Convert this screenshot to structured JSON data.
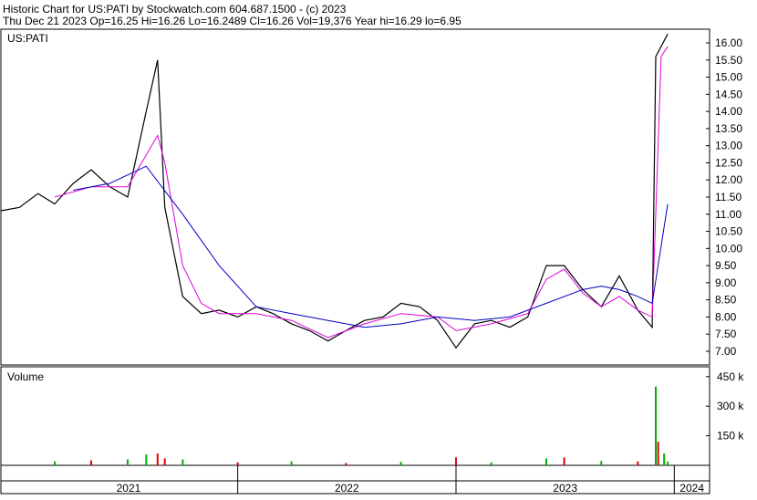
{
  "header": {
    "line1": "Historic Chart for US:PATI by Stockwatch.com 604.687.1500 - (c) 2023",
    "line2": "Thu Dec 21 2023   Op=16.25   Hi=16.26   Lo=16.2489   Cl=16.26   Vol=19,376   Year hi=16.29   lo=6.95"
  },
  "colors": {
    "price": "#000000",
    "ma_short": "#e000e0",
    "ma_long": "#0000c0",
    "vol_up": "#00b000",
    "vol_down": "#e00000",
    "grid": "#000000"
  },
  "chart_data": [
    {
      "type": "line",
      "title": "US:PATI",
      "x_labels": [
        "2021",
        "2022",
        "2023",
        "2024"
      ],
      "ylim": [
        6.6,
        16.4
      ],
      "y_ticks": [
        "7.00",
        "7.50",
        "8.00",
        "8.50",
        "9.00",
        "9.50",
        "10.00",
        "10.50",
        "11.00",
        "11.50",
        "12.00",
        "12.50",
        "13.00",
        "13.50",
        "14.00",
        "14.50",
        "15.00",
        "15.50",
        "16.00"
      ],
      "series": [
        {
          "key": "price",
          "points": [
            [
              "2020-12",
              11.1
            ],
            [
              "2021-01",
              11.2
            ],
            [
              "2021-02",
              11.6
            ],
            [
              "2021-03",
              11.3
            ],
            [
              "2021-04",
              11.9
            ],
            [
              "2021-05",
              12.3
            ],
            [
              "2021-06",
              11.8
            ],
            [
              "2021-07",
              11.5
            ],
            [
              "2021-08",
              14.0
            ],
            [
              "2021-08-20",
              15.5
            ],
            [
              "2021-09",
              11.2
            ],
            [
              "2021-10",
              8.6
            ],
            [
              "2021-11",
              8.1
            ],
            [
              "2021-12",
              8.2
            ],
            [
              "2022-01",
              8.0
            ],
            [
              "2022-02",
              8.3
            ],
            [
              "2022-03",
              8.1
            ],
            [
              "2022-04",
              7.8
            ],
            [
              "2022-05",
              7.6
            ],
            [
              "2022-06",
              7.3
            ],
            [
              "2022-07",
              7.6
            ],
            [
              "2022-08",
              7.9
            ],
            [
              "2022-09",
              8.0
            ],
            [
              "2022-10",
              8.4
            ],
            [
              "2022-11",
              8.3
            ],
            [
              "2022-12",
              7.9
            ],
            [
              "2023-01",
              7.1
            ],
            [
              "2023-02",
              7.8
            ],
            [
              "2023-03",
              7.9
            ],
            [
              "2023-04",
              7.7
            ],
            [
              "2023-05",
              8.0
            ],
            [
              "2023-06",
              9.5
            ],
            [
              "2023-07",
              9.5
            ],
            [
              "2023-08",
              8.8
            ],
            [
              "2023-09",
              8.3
            ],
            [
              "2023-10",
              9.2
            ],
            [
              "2023-11",
              8.2
            ],
            [
              "2023-11-25",
              7.7
            ],
            [
              "2023-12-01",
              15.6
            ],
            [
              "2023-12-21",
              16.26
            ]
          ]
        },
        {
          "key": "ma_short",
          "points": [
            [
              "2021-03",
              11.5
            ],
            [
              "2021-05",
              11.8
            ],
            [
              "2021-07",
              11.8
            ],
            [
              "2021-08-20",
              13.3
            ],
            [
              "2021-09",
              12.5
            ],
            [
              "2021-10",
              9.5
            ],
            [
              "2021-11",
              8.4
            ],
            [
              "2021-12",
              8.1
            ],
            [
              "2022-02",
              8.1
            ],
            [
              "2022-04",
              7.9
            ],
            [
              "2022-06",
              7.4
            ],
            [
              "2022-08",
              7.8
            ],
            [
              "2022-10",
              8.1
            ],
            [
              "2022-12",
              8.0
            ],
            [
              "2023-01",
              7.6
            ],
            [
              "2023-03",
              7.8
            ],
            [
              "2023-05",
              8.1
            ],
            [
              "2023-06",
              9.1
            ],
            [
              "2023-07",
              9.4
            ],
            [
              "2023-08",
              8.7
            ],
            [
              "2023-09",
              8.3
            ],
            [
              "2023-10",
              8.6
            ],
            [
              "2023-11",
              8.2
            ],
            [
              "2023-11-25",
              8.0
            ],
            [
              "2023-12-10",
              15.6
            ],
            [
              "2023-12-21",
              15.9
            ]
          ]
        },
        {
          "key": "ma_long",
          "points": [
            [
              "2021-04",
              11.7
            ],
            [
              "2021-06",
              11.9
            ],
            [
              "2021-08",
              12.4
            ],
            [
              "2021-10",
              11.0
            ],
            [
              "2021-12",
              9.5
            ],
            [
              "2022-02",
              8.3
            ],
            [
              "2022-04",
              8.1
            ],
            [
              "2022-06",
              7.9
            ],
            [
              "2022-08",
              7.7
            ],
            [
              "2022-10",
              7.8
            ],
            [
              "2022-12",
              8.0
            ],
            [
              "2023-02",
              7.9
            ],
            [
              "2023-04",
              8.0
            ],
            [
              "2023-06",
              8.4
            ],
            [
              "2023-08",
              8.8
            ],
            [
              "2023-09",
              8.9
            ],
            [
              "2023-10",
              8.8
            ],
            [
              "2023-11",
              8.6
            ],
            [
              "2023-11-25",
              8.4
            ],
            [
              "2023-12-21",
              11.3
            ]
          ]
        }
      ]
    },
    {
      "type": "bar",
      "title": "Volume",
      "ylim": [
        0,
        500000
      ],
      "y_ticks": [
        {
          "value": 150000,
          "label": "150 k"
        },
        {
          "value": 300000,
          "label": "300 k"
        },
        {
          "value": 450000,
          "label": "450 k"
        }
      ],
      "bars": [
        [
          "2021-03",
          20000,
          "up"
        ],
        [
          "2021-05",
          25000,
          "down"
        ],
        [
          "2021-07",
          30000,
          "up"
        ],
        [
          "2021-08",
          55000,
          "up"
        ],
        [
          "2021-08-20",
          60000,
          "down"
        ],
        [
          "2021-09",
          35000,
          "down"
        ],
        [
          "2021-10",
          30000,
          "up"
        ],
        [
          "2022-01",
          15000,
          "down"
        ],
        [
          "2022-04",
          20000,
          "up"
        ],
        [
          "2022-07",
          12000,
          "down"
        ],
        [
          "2022-10",
          18000,
          "up"
        ],
        [
          "2023-01",
          40000,
          "down"
        ],
        [
          "2023-03",
          15000,
          "up"
        ],
        [
          "2023-06",
          35000,
          "up"
        ],
        [
          "2023-07",
          40000,
          "down"
        ],
        [
          "2023-09",
          22000,
          "up"
        ],
        [
          "2023-11",
          20000,
          "down"
        ],
        [
          "2023-12-01",
          400000,
          "up"
        ],
        [
          "2023-12-05",
          120000,
          "down"
        ],
        [
          "2023-12-15",
          60000,
          "up"
        ],
        [
          "2023-12-21",
          19376,
          "up"
        ]
      ]
    }
  ]
}
